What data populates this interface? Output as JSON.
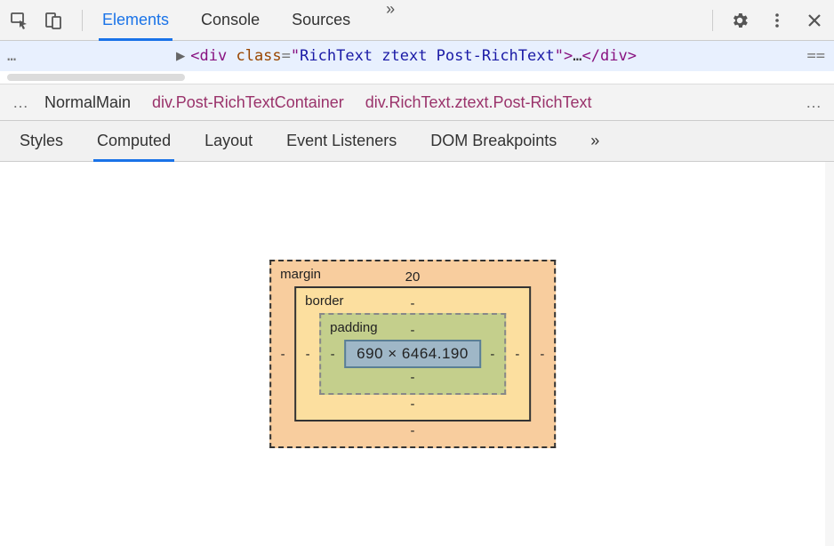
{
  "toolbar": {
    "tabs": [
      "Elements",
      "Console",
      "Sources"
    ],
    "active_tab": "Elements",
    "more": "»"
  },
  "dom_line": {
    "left_dots": "…",
    "triangle": "▶",
    "open_lt": "<",
    "tag": "div",
    "attr_name": "class",
    "eq": "=",
    "q": "\"",
    "attr_val": "RichText ztext Post-RichText",
    "close_gt": ">",
    "ellipsis": "…",
    "close_open": "</",
    "eq_marker": "=="
  },
  "breadcrumb": {
    "left_more": "…",
    "items": [
      "NormalMain",
      "div.Post-RichTextContainer",
      "div.RichText.ztext.Post-RichText"
    ],
    "right_more": "…"
  },
  "subtabs": {
    "items": [
      "Styles",
      "Computed",
      "Layout",
      "Event Listeners",
      "DOM Breakpoints"
    ],
    "active": "Computed",
    "more": "»"
  },
  "box_model": {
    "labels": {
      "margin": "margin",
      "border": "border",
      "padding": "padding"
    },
    "margin": {
      "top": "20",
      "right": "-",
      "bottom": "-",
      "left": "-"
    },
    "border": {
      "top": "-",
      "right": "-",
      "bottom": "-",
      "left": "-"
    },
    "padding": {
      "top": "-",
      "right": "-",
      "bottom": "-",
      "left": "-"
    },
    "content": "690 × 6464.190"
  }
}
